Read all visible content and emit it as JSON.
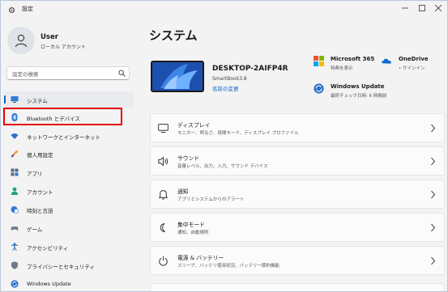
{
  "window": {
    "title": "設定"
  },
  "profile": {
    "name": "User",
    "account_type": "ローカル アカウント"
  },
  "search": {
    "placeholder": "設定の検索"
  },
  "sidebar": {
    "items": [
      {
        "label": "システム",
        "icon": "monitor-icon",
        "selected": true
      },
      {
        "label": "Bluetooth とデバイス",
        "icon": "bluetooth-icon",
        "selected": false
      },
      {
        "label": "ネットワークとインターネット",
        "icon": "wifi-icon",
        "selected": false
      },
      {
        "label": "個人用設定",
        "icon": "brush-icon",
        "selected": false
      },
      {
        "label": "アプリ",
        "icon": "apps-icon",
        "selected": false
      },
      {
        "label": "アカウント",
        "icon": "person-icon",
        "selected": false
      },
      {
        "label": "時刻と言語",
        "icon": "globe-clock-icon",
        "selected": false
      },
      {
        "label": "ゲーム",
        "icon": "gamepad-icon",
        "selected": false
      },
      {
        "label": "アクセシビリティ",
        "icon": "accessibility-icon",
        "selected": false
      },
      {
        "label": "プライバシーとセキュリティ",
        "icon": "shield-icon",
        "selected": false
      },
      {
        "label": "Windows Update",
        "icon": "sync-icon",
        "selected": false
      }
    ],
    "highlighted_item": "Bluetooth とデバイス"
  },
  "main": {
    "title": "システム",
    "device": {
      "name": "DESKTOP-2AIFP4R",
      "model": "SmartBook3.8",
      "rename_link": "名前の変更"
    },
    "tiles": {
      "microsoft365": {
        "label": "Microsoft 365",
        "sub": "特典を表示"
      },
      "onedrive": {
        "label": "OneDrive",
        "sub": "• サインイン"
      },
      "windows_update": {
        "label": "Windows Update",
        "sub": "最終チェック日時: 6 時間前"
      }
    },
    "cards": [
      {
        "title": "ディスプレイ",
        "sub": "モニター、明るさ、夜間モード、ディスプレイ プロファイル",
        "icon": "display-icon"
      },
      {
        "title": "サウンド",
        "sub": "音量レベル、出力、入力、サウンド デバイス",
        "icon": "speaker-icon"
      },
      {
        "title": "通知",
        "sub": "アプリとシステムからのアラート",
        "icon": "bell-icon"
      },
      {
        "title": "集中モード",
        "sub": "通知、自動規則",
        "icon": "moon-icon"
      },
      {
        "title": "電源 & バッテリー",
        "sub": "スリープ、バッテリ使用状況、バッテリー節約機能",
        "icon": "power-icon"
      }
    ]
  },
  "colors": {
    "accent": "#0a64c2",
    "highlight_border": "#e30000",
    "background": "#f3f3f3"
  }
}
